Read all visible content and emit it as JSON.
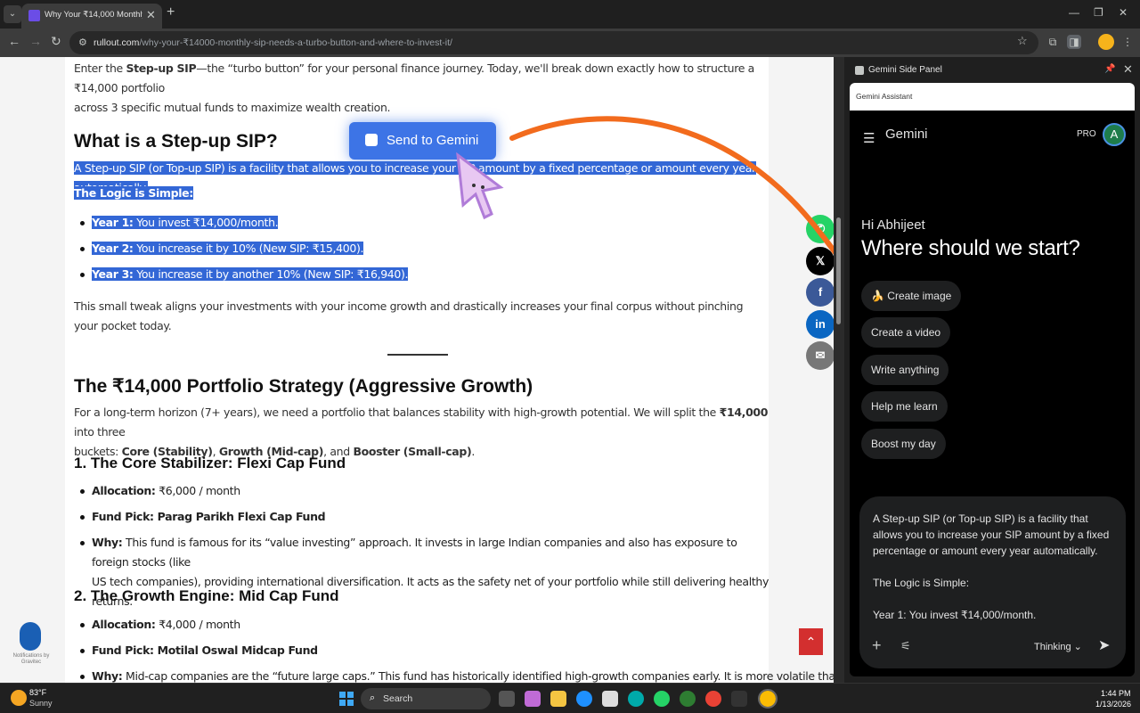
{
  "browser": {
    "tab_title": "Why Your ₹14,000 Monthly SIP",
    "url_domain": "rullout.com",
    "url_path": "/why-your-₹14000-monthly-sip-needs-a-turbo-button-and-where-to-invest-it/"
  },
  "article": {
    "intro_line1_pre": "Enter the ",
    "intro_line1_bold": "Step-up SIP",
    "intro_line1_post": "—the “turbo button” for your personal finance journey. Today, we'll break down exactly how to structure a ₹14,000 portfolio",
    "intro_line2": "across 3 specific mutual funds to maximize wealth creation.",
    "h_stepup": "What is a Step-up SIP?",
    "stepup_def": "A Step-up SIP (or Top-up SIP) is a facility that allows you to increase your SIP amount by a fixed percentage or amount every year automatically.",
    "logic_label": "The Logic is Simple:",
    "years": [
      {
        "label": "Year 1:",
        "text": " You invest ₹14,000/month."
      },
      {
        "label": "Year 2:",
        "text": " You increase it by 10% (New SIP: ₹15,400)."
      },
      {
        "label": "Year 3:",
        "text": " You increase it by another 10% (New SIP: ₹16,940)."
      }
    ],
    "tweak": "This small tweak aligns your investments with your income growth and drastically increases your final corpus without pinching your pocket today.",
    "h_portfolio": "The ₹14,000 Portfolio Strategy (Aggressive Growth)",
    "portfolio_line1_pre": "For a long-term horizon (7+ years), we need a portfolio that balances stability with high-growth potential. We will split the ",
    "portfolio_line1_bold": "₹14,000",
    "portfolio_line1_post": " into three",
    "portfolio_line2_pre": "buckets: ",
    "bucket_core": "Core (Stability)",
    "bucket_growth": "Growth (Mid-cap)",
    "bucket_booster": "Booster (Small-cap)",
    "h_core": "1. The Core Stabilizer: Flexi Cap Fund",
    "core_alloc_label": "Allocation:",
    "core_alloc": " ₹6,000 / month",
    "core_fund": "Fund Pick: Parag Parikh Flexi Cap Fund",
    "core_why_label": "Why:",
    "core_why_1": " This fund is famous for its “value investing” approach. It invests in large Indian companies and also has exposure to foreign stocks (like",
    "core_why_2": "US tech companies), providing international diversification. It acts as the safety net of your portfolio while still delivering healthy returns.",
    "h_growth": "2. The Growth Engine: Mid Cap Fund",
    "growth_alloc_label": "Allocation:",
    "growth_alloc": " ₹4,000 / month",
    "growth_fund": "Fund Pick: Motilal Oswal Midcap Fund",
    "growth_why_label": "Why:",
    "growth_why": " Mid-cap companies are the “future large caps.” This fund has historically identified high-growth companies early. It is more volatile than"
  },
  "overlay": {
    "send_label": "Send to Gemini"
  },
  "notifications": {
    "label": "Notifications by Gravitec"
  },
  "side_panel": {
    "header_title": "Gemini Side Panel",
    "inner_title": "Gemini Assistant",
    "app_name": "Gemini",
    "plan_badge": "PRO",
    "avatar_letter": "A",
    "greeting": "Hi Abhijeet",
    "headline": "Where should we start?",
    "chips": [
      "🍌 Create image",
      "Create a video",
      "Write anything",
      "Help me learn",
      "Boost my day"
    ],
    "prompt_text": "A Step-up SIP (or Top-up SIP) is a facility that allows you to increase your SIP amount by a fixed percentage or amount every year automatically.\n\nThe Logic is Simple:\n\nYear 1: You invest ₹14,000/month.",
    "mode_label": "Thinking"
  },
  "taskbar": {
    "temperature": "83°F",
    "condition": "Sunny",
    "search_label": "Search",
    "time": "1:44 PM",
    "date": "1/13/2026"
  },
  "colors": {
    "highlight": "#3367d6",
    "send_button": "#3d74e6",
    "annotation_arrow": "#f26b1d"
  }
}
